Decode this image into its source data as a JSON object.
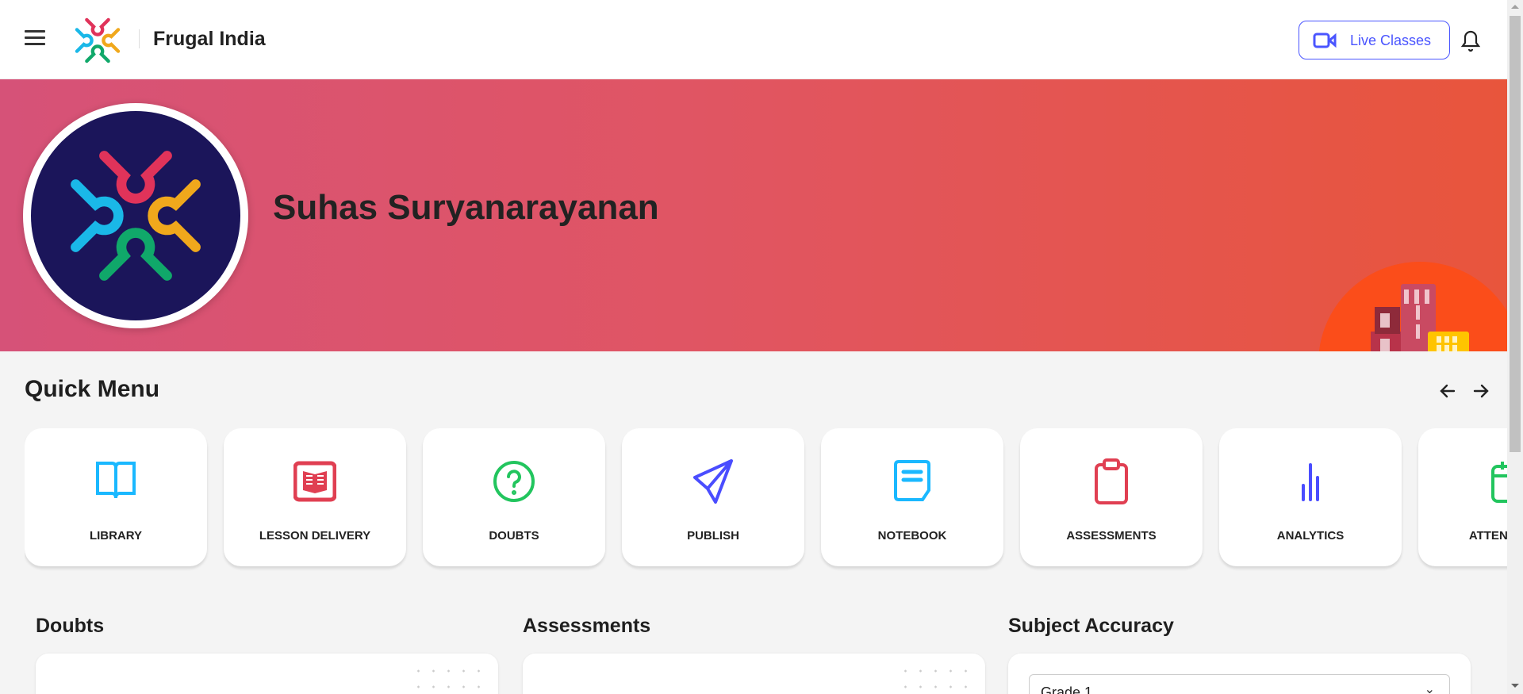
{
  "header": {
    "brand": "Frugal India",
    "live_classes_label": "Live Classes"
  },
  "banner": {
    "user_name": "Suhas Suryanarayanan"
  },
  "quick_menu": {
    "title": "Quick Menu",
    "items": [
      {
        "label": "LIBRARY",
        "icon": "book-open-icon",
        "color": "#1ab8ff"
      },
      {
        "label": "LESSON DELIVERY",
        "icon": "lesson-book-icon",
        "color": "#e03f52"
      },
      {
        "label": "DOUBTS",
        "icon": "question-circle-icon",
        "color": "#22c55e"
      },
      {
        "label": "PUBLISH",
        "icon": "send-icon",
        "color": "#4a4dff"
      },
      {
        "label": "NOTEBOOK",
        "icon": "note-icon",
        "color": "#1ab8ff"
      },
      {
        "label": "ASSESSMENTS",
        "icon": "clipboard-icon",
        "color": "#e03f52"
      },
      {
        "label": "ANALYTICS",
        "icon": "bar-chart-icon",
        "color": "#4a4dff"
      },
      {
        "label": "ATTENDANCE",
        "icon": "calendar-icon",
        "color": "#22c55e"
      }
    ]
  },
  "sections": {
    "doubts": {
      "title": "Doubts"
    },
    "assessments": {
      "title": "Assessments"
    },
    "subject_accuracy": {
      "title": "Subject Accuracy",
      "grade_select": "Grade 1"
    }
  },
  "colors": {
    "accent": "#4a55ff",
    "banner_start": "#d65278",
    "banner_end": "#e8553c"
  }
}
